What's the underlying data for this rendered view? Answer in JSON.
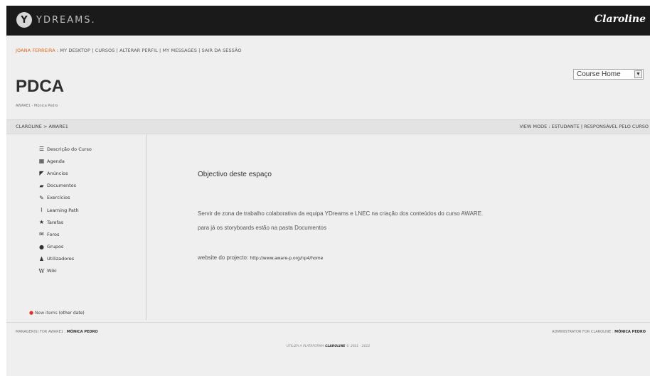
{
  "header": {
    "logo_text": "YDREAMS.",
    "brand": "Claroline"
  },
  "user_nav": {
    "user": "JOANA FERREIRA",
    "links": [
      "MY DESKTOP",
      "CURSOS",
      "ALTERAR PERFIL",
      "MY MESSAGES",
      "SAIR DA SESSÃO"
    ]
  },
  "course": {
    "title": "PDCA",
    "subtitle": "AWARE1 - Mónica Pedro",
    "select_value": "Course Home"
  },
  "breadcrumb": {
    "root": "CLAROLINE",
    "current": "AWARE1"
  },
  "view_mode": {
    "label": "VIEW MODE :",
    "student": "ESTUDANTE",
    "manager": "RESPONSÁVEL PELO CURSO"
  },
  "sidebar": {
    "items": [
      {
        "label": "Descrição do Curso",
        "icon": "list-icon"
      },
      {
        "label": "Agenda",
        "icon": "calendar-icon"
      },
      {
        "label": "Anúncios",
        "icon": "megaphone-icon"
      },
      {
        "label": "Documentos",
        "icon": "folder-icon"
      },
      {
        "label": "Exercícios",
        "icon": "pencil-icon"
      },
      {
        "label": "Learning Path",
        "icon": "path-icon"
      },
      {
        "label": "Tarefas",
        "icon": "star-icon"
      },
      {
        "label": "Foros",
        "icon": "forum-icon"
      },
      {
        "label": "Grupos",
        "icon": "group-icon"
      },
      {
        "label": "Utilizadores",
        "icon": "user-icon"
      },
      {
        "label": "Wiki",
        "icon": "wiki-icon"
      }
    ],
    "new_items": "New items",
    "other_date": "(other date)"
  },
  "content": {
    "title": "Objectivo deste espaço",
    "paragraph1": "Servir de zona de trabalho colaborativa da equipa YDreams e LNEC na criação dos conteúdos do curso AWARE.",
    "paragraph2": "para já os storyboards estão na pasta Documentos",
    "website_label": "website do projecto:",
    "website_url": "http://www.aware-p.org/np4/home"
  },
  "footer": {
    "managers_label": "MANAGER(S) FOR AWARE1 :",
    "managers_name": "MÓNICA PEDRO",
    "admin_label": "ADMINISTRATOR FOR CLAROLINE :",
    "admin_name": "MÓNICA PEDRO",
    "powered_by": "UTILIZA A PLATAFORMA",
    "powered_brand": "CLAROLINE",
    "powered_years": "© 2001 - 2012"
  }
}
